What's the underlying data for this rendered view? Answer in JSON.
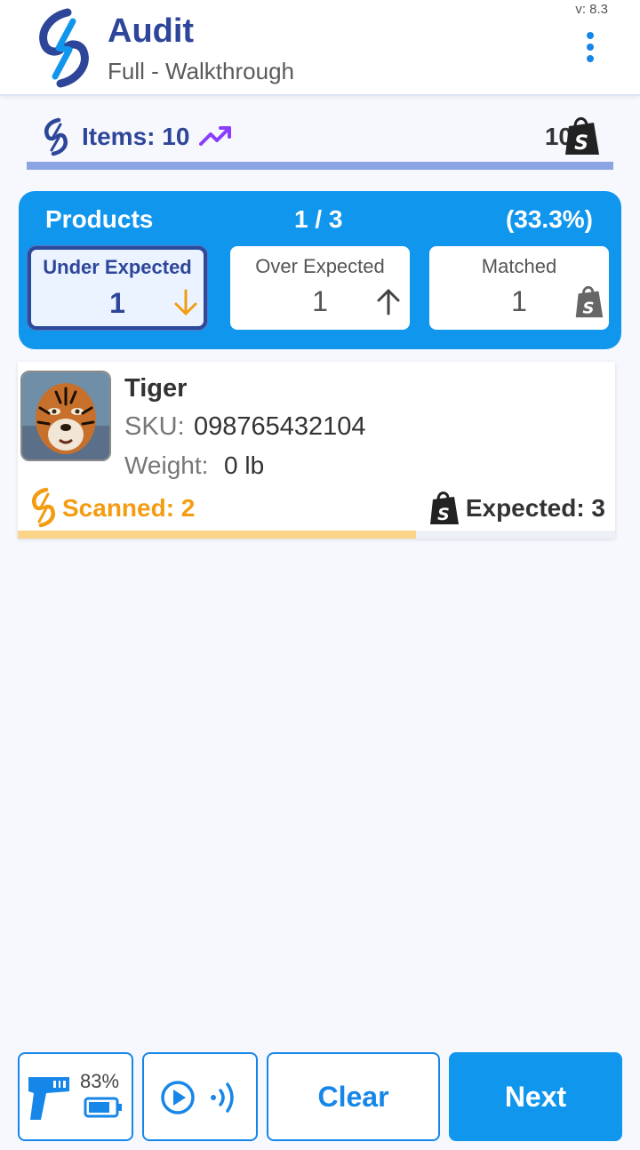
{
  "header": {
    "title": "Audit",
    "subtitle": "Full - Walkthrough",
    "version": "v: 8.3"
  },
  "items_bar": {
    "label": "Items: 10",
    "shop_count": "10",
    "progress_fraction": 1.0
  },
  "products": {
    "label": "Products",
    "count": "1 / 3",
    "percent": "(33.3%)",
    "cards": [
      {
        "title": "Under Expected",
        "value": "1",
        "icon": "arrow-down-icon",
        "active": true
      },
      {
        "title": "Over Expected",
        "value": "1",
        "icon": "arrow-up-icon",
        "active": false
      },
      {
        "title": "Matched",
        "value": "1",
        "icon": "shopify-bag-icon",
        "active": false
      }
    ]
  },
  "product_card": {
    "name": "Tiger",
    "sku_label": "SKU:",
    "sku": "098765432104",
    "weight_label": "Weight:",
    "weight": "0 lb",
    "scanned": "Scanned: 2",
    "expected": "Expected: 3",
    "progress_fraction": 0.6667
  },
  "bottom_bar": {
    "battery": "83%",
    "clear_label": "Clear",
    "next_label": "Next"
  },
  "colors": {
    "brand_blue": "#2e4699",
    "accent_blue": "#1196ee",
    "scan_orange": "#f39c12",
    "trend_purple": "#8b3dff"
  }
}
